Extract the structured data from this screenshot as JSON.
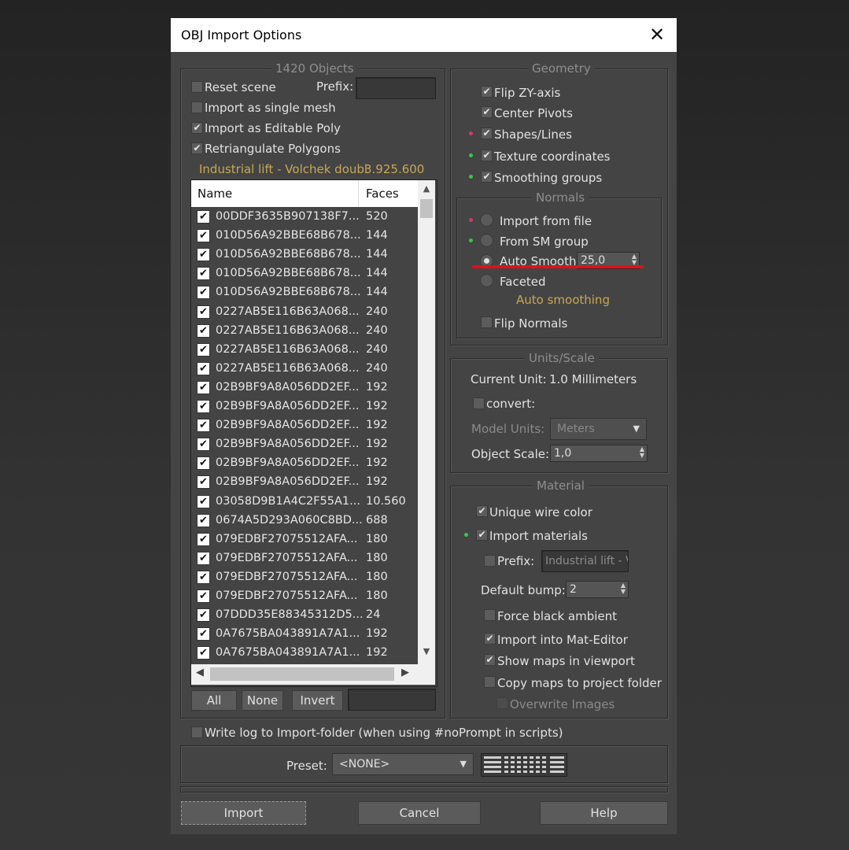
{
  "window": {
    "title": "OBJ Import Options",
    "close_glyph": "✕"
  },
  "objects_group": {
    "title": "1420 Objects",
    "reset_scene": {
      "label": "Reset scene",
      "checked": false
    },
    "prefix_label": "Prefix:",
    "prefix_value": "",
    "single_mesh": {
      "label": "Import as single mesh",
      "checked": false
    },
    "editable_poly": {
      "label": "Import as Editable Poly",
      "checked": true
    },
    "retriangulate": {
      "label": "Retriangulate Polygons",
      "checked": true
    },
    "selected_name": "Industrial lift - Volchek doubl",
    "selected_faces": "3.925.600",
    "columns": {
      "name": "Name",
      "faces": "Faces"
    },
    "rows": [
      {
        "name": "00DDF3635B907138F7...",
        "faces": "520"
      },
      {
        "name": "010D56A92BBE68B678...",
        "faces": "144"
      },
      {
        "name": "010D56A92BBE68B678...",
        "faces": "144"
      },
      {
        "name": "010D56A92BBE68B678...",
        "faces": "144"
      },
      {
        "name": "010D56A92BBE68B678...",
        "faces": "144"
      },
      {
        "name": "0227AB5E116B63A068...",
        "faces": "240"
      },
      {
        "name": "0227AB5E116B63A068...",
        "faces": "240"
      },
      {
        "name": "0227AB5E116B63A068...",
        "faces": "240"
      },
      {
        "name": "0227AB5E116B63A068...",
        "faces": "240"
      },
      {
        "name": "02B9BF9A8A056DD2EF...",
        "faces": "192"
      },
      {
        "name": "02B9BF9A8A056DD2EF...",
        "faces": "192"
      },
      {
        "name": "02B9BF9A8A056DD2EF...",
        "faces": "192"
      },
      {
        "name": "02B9BF9A8A056DD2EF...",
        "faces": "192"
      },
      {
        "name": "02B9BF9A8A056DD2EF...",
        "faces": "192"
      },
      {
        "name": "02B9BF9A8A056DD2EF...",
        "faces": "192"
      },
      {
        "name": "03058D9B1A4C2F55A1...",
        "faces": "10.560"
      },
      {
        "name": "0674A5D293A060C8BD...",
        "faces": "688"
      },
      {
        "name": "079EDBF27075512AFA...",
        "faces": "180"
      },
      {
        "name": "079EDBF27075512AFA...",
        "faces": "180"
      },
      {
        "name": "079EDBF27075512AFA...",
        "faces": "180"
      },
      {
        "name": "079EDBF27075512AFA...",
        "faces": "180"
      },
      {
        "name": "07DDD35E88345312D5...",
        "faces": "24"
      },
      {
        "name": "0A7675BA043891A7A1...",
        "faces": "192"
      },
      {
        "name": "0A7675BA043891A7A1...",
        "faces": "192"
      }
    ],
    "buttons": {
      "all": "All",
      "none": "None",
      "invert": "Invert"
    },
    "filter_value": ""
  },
  "geometry_group": {
    "title": "Geometry",
    "flip_zy": {
      "label": "Flip ZY-axis",
      "checked": true
    },
    "center_pivots": {
      "label": "Center Pivots",
      "checked": true
    },
    "shapes_lines": {
      "label": "Shapes/Lines",
      "checked": true
    },
    "texture_coords": {
      "label": "Texture coordinates",
      "checked": true
    },
    "smoothing_groups": {
      "label": "Smoothing groups",
      "checked": true
    }
  },
  "normals_group": {
    "title": "Normals",
    "import_from_file": "Import from file",
    "from_sm_group": "From SM group",
    "auto_smooth": "Auto Smooth:",
    "auto_smooth_value": "25,0",
    "faceted": "Faceted",
    "status": "Auto smoothing",
    "flip_normals": {
      "label": "Flip Normals",
      "checked": false
    },
    "selected": "auto_smooth"
  },
  "units_group": {
    "title": "Units/Scale",
    "current_unit_label": "Current Unit:",
    "current_unit_value": "1.0 Millimeters",
    "convert": {
      "label": "convert:",
      "checked": false
    },
    "model_units_label": "Model Units:",
    "model_units_value": "Meters",
    "object_scale_label": "Object Scale:",
    "object_scale_value": "1,0"
  },
  "material_group": {
    "title": "Material",
    "unique_wire": {
      "label": "Unique wire color",
      "checked": true
    },
    "import_materials": {
      "label": "Import materials",
      "checked": true
    },
    "prefix": {
      "label": "Prefix:",
      "checked": false,
      "value": "Industrial lift - V"
    },
    "default_bump_label": "Default bump:",
    "default_bump_value": "2",
    "force_black": {
      "label": "Force black ambient",
      "checked": false
    },
    "mat_editor": {
      "label": "Import into Mat-Editor",
      "checked": true
    },
    "show_maps": {
      "label": "Show maps in viewport",
      "checked": true
    },
    "copy_maps": {
      "label": "Copy maps to project folder",
      "checked": false
    },
    "overwrite": {
      "label": "Overwrite Images",
      "checked": false
    }
  },
  "write_log": {
    "label": "Write log to Import-folder (when using #noPrompt in scripts)",
    "checked": false
  },
  "preset": {
    "label": "Preset:",
    "value": "<NONE>"
  },
  "footer": {
    "import": "Import",
    "cancel": "Cancel",
    "help": "Help"
  },
  "colors": {
    "highlight_underline": "#e0101a",
    "status_text": "#c9a752"
  }
}
